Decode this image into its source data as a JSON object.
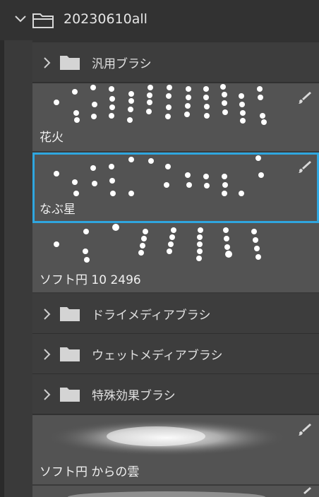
{
  "root_folder": {
    "label": "20230610all",
    "expanded": true
  },
  "items": [
    {
      "type": "folder",
      "label": "汎用ブラシ",
      "expanded": false
    },
    {
      "type": "brush",
      "label": "花火"
    },
    {
      "type": "brush",
      "label": "なぶ星",
      "selected": true
    },
    {
      "type": "brush",
      "label": "ソフト円 10 2496"
    },
    {
      "type": "folder",
      "label": "ドライメディアブラシ",
      "expanded": false
    },
    {
      "type": "folder",
      "label": "ウェットメディアブラシ",
      "expanded": false
    },
    {
      "type": "folder",
      "label": "特殊効果ブラシ",
      "expanded": false
    },
    {
      "type": "brush",
      "label": "ソフト円 からの雲"
    }
  ],
  "colors": {
    "selection": "#2fa6df",
    "panel": "#323232",
    "brush_row": "#535353"
  }
}
